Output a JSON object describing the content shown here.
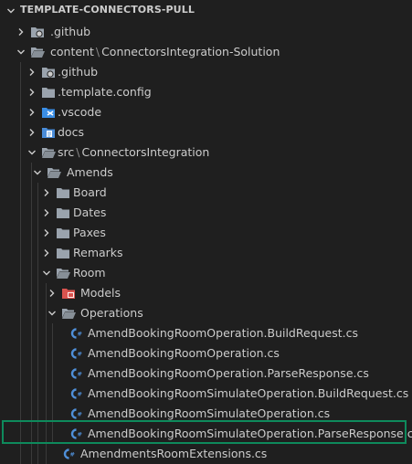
{
  "section": {
    "title": "TEMPLATE-CONNECTORS-PULL"
  },
  "colors": {
    "background": "#1f1f1f",
    "text": "#cccccc",
    "folder": "#9aa3ad",
    "csharp": "#4f8fd8",
    "vscode": "#3a8ee6",
    "docs": "#4a8cd8",
    "models": "#d9534f",
    "highlight_border": "#0e8a5c"
  },
  "tree": [
    {
      "label": ".github",
      "kind": "folder-github",
      "state": "collapsed",
      "depth": 0
    },
    {
      "label_main": "content",
      "label_sub": "ConnectorsIntegration-Solution",
      "separator": "\\",
      "kind": "folder",
      "state": "expanded",
      "depth": 0
    },
    {
      "label": ".github",
      "kind": "folder-github",
      "state": "collapsed",
      "depth": 1
    },
    {
      "label": ".template.config",
      "kind": "folder",
      "state": "collapsed",
      "depth": 1
    },
    {
      "label": ".vscode",
      "kind": "folder-vscode",
      "state": "collapsed",
      "depth": 1
    },
    {
      "label": "docs",
      "kind": "folder-docs",
      "state": "collapsed",
      "depth": 1
    },
    {
      "label_main": "src",
      "label_sub": "ConnectorsIntegration",
      "separator": "\\",
      "kind": "folder",
      "state": "expanded",
      "depth": 1
    },
    {
      "label": "Amends",
      "kind": "folder",
      "state": "expanded",
      "depth": 2
    },
    {
      "label": "Board",
      "kind": "folder",
      "state": "collapsed",
      "depth": 3
    },
    {
      "label": "Dates",
      "kind": "folder",
      "state": "collapsed",
      "depth": 3
    },
    {
      "label": "Paxes",
      "kind": "folder",
      "state": "collapsed",
      "depth": 3
    },
    {
      "label": "Remarks",
      "kind": "folder",
      "state": "collapsed",
      "depth": 3
    },
    {
      "label": "Room",
      "kind": "folder",
      "state": "expanded",
      "depth": 3
    },
    {
      "label": "Models",
      "kind": "folder-models",
      "state": "collapsed",
      "depth": 4
    },
    {
      "label": "Operations",
      "kind": "folder",
      "state": "expanded",
      "depth": 4
    },
    {
      "label": "AmendBookingRoomOperation.BuildRequest.cs",
      "kind": "csharp",
      "depth": 5
    },
    {
      "label": "AmendBookingRoomOperation.cs",
      "kind": "csharp",
      "depth": 5
    },
    {
      "label": "AmendBookingRoomOperation.ParseResponse.cs",
      "kind": "csharp",
      "depth": 5
    },
    {
      "label": "AmendBookingRoomSimulateOperation.BuildRequest.cs",
      "kind": "csharp",
      "depth": 5
    },
    {
      "label": "AmendBookingRoomSimulateOperation.cs",
      "kind": "csharp",
      "depth": 5
    },
    {
      "label": "AmendBookingRoomSimulateOperation.ParseResponse.cs",
      "kind": "csharp",
      "depth": 5,
      "highlighted": true
    },
    {
      "label": "AmendmentsRoomExtensions.cs",
      "kind": "csharp",
      "depth": 4
    }
  ]
}
